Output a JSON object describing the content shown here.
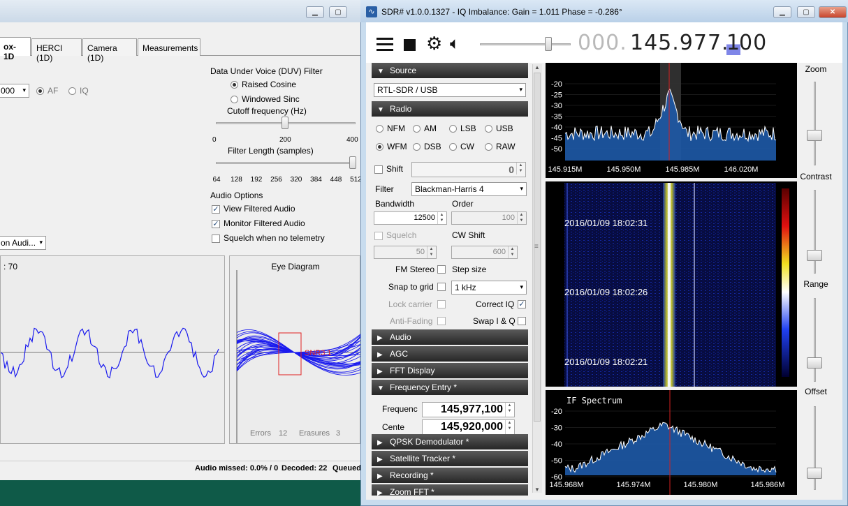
{
  "left_window": {
    "tabs": [
      "ox-1D",
      "HERCI (1D)",
      "Camera (1D)",
      "Measurements"
    ],
    "duv_filter": {
      "title": "Data Under Voice (DUV) Filter",
      "raised_cosine": "Raised Cosine",
      "windowed_sinc": "Windowed Sinc",
      "cutoff_label": "Cutoff frequency (Hz)",
      "cutoff_ticks": [
        "0",
        "200",
        "400"
      ],
      "length_label": "Filter Length (samples)",
      "length_ticks": [
        "64",
        "128",
        "192",
        "256",
        "320",
        "384",
        "448",
        "512"
      ]
    },
    "source_select": "000",
    "af_label": "AF",
    "iq_label": "IQ",
    "audio_options": {
      "title": "Audio Options",
      "view_filtered": "View Filtered Audio",
      "monitor_filtered": "Monitor Filtered Audio",
      "squelch_no_telemetry": "Squelch when no telemetry"
    },
    "audio_select": "on Audi...",
    "plot1_title": ": 70",
    "eye_title": "Eye Diagram",
    "snr_label": "SNR3.1",
    "errors_label": "Errors",
    "errors_value": "12",
    "erasures_label": "Erasures",
    "erasures_value": "3",
    "status": {
      "audio_missed": "Audio missed: 0.0% / 0",
      "decoded": "Decoded: 22",
      "queued": "Queued"
    }
  },
  "sdr": {
    "title": "SDR# v1.0.0.1327 - IQ Imbalance: Gain = 1.011 Phase = -0.286°",
    "freq_dim": "000.",
    "freq_main": "145.977.",
    "freq_hi": "1",
    "freq_tail": "00",
    "sections": {
      "source": "Source",
      "radio": "Radio",
      "audio": "Audio",
      "agc": "AGC",
      "fft_display": "FFT Display",
      "frequency_entry": "Frequency Entry *",
      "qpsk": "QPSK Demodulator *",
      "sat_tracker": "Satellite Tracker *",
      "recording": "Recording *",
      "zoom_fft": "Zoom FFT *"
    },
    "source_device": "RTL-SDR / USB",
    "modes": [
      "NFM",
      "AM",
      "LSB",
      "USB",
      "WFM",
      "DSB",
      "CW",
      "RAW"
    ],
    "selected_mode": "WFM",
    "shift_label": "Shift",
    "shift_value": "0",
    "filter_label": "Filter",
    "filter_value": "Blackman-Harris 4",
    "bandwidth_label": "Bandwidth",
    "bandwidth_value": "12500",
    "order_label": "Order",
    "order_value": "100",
    "squelch_label": "Squelch",
    "squelch_value": "50",
    "cwshift_label": "CW Shift",
    "cwshift_value": "600",
    "fm_stereo": "FM Stereo",
    "step_size": "Step size",
    "snap_grid": "Snap to grid",
    "step_value": "1 kHz",
    "lock_carrier": "Lock carrier",
    "correct_iq": "Correct IQ",
    "anti_fading": "Anti-Fading",
    "swap_iq": "Swap I & Q",
    "frequency_label": "Frequenc",
    "frequency_value": "145,977,100",
    "center_label": "Cente",
    "center_value": "145,920,000",
    "spectrum_db": [
      "-20",
      "-25",
      "-30",
      "-35",
      "-40",
      "-45",
      "-50"
    ],
    "spectrum_freqs": [
      "145.915M",
      "145.950M",
      "145.985M",
      "146.020M"
    ],
    "waterfall_times": [
      "2016/01/09 18:02:31",
      "2016/01/09 18:02:26",
      "2016/01/09 18:02:21"
    ],
    "if_title": "IF Spectrum",
    "if_db": [
      "-20",
      "-30",
      "-40",
      "-50",
      "-60"
    ],
    "if_freqs": [
      "145.968M",
      "145.974M",
      "145.980M",
      "145.986M"
    ],
    "right_labels": {
      "zoom": "Zoom",
      "contrast": "Contrast",
      "range": "Range",
      "offset": "Offset"
    }
  },
  "colors": {
    "spectrum_fill": "#1e5aa8",
    "center_line": "#d42020",
    "signal_trace": "#1a1aee"
  }
}
